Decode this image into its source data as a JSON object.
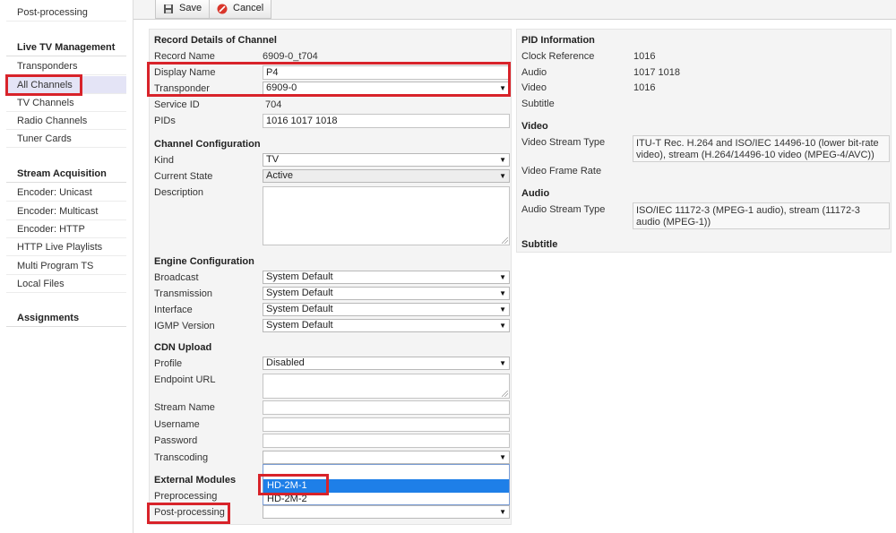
{
  "sidebar": {
    "top_item": "Post-processing",
    "section1": "Live TV Management",
    "items1": [
      "Transponders",
      "All Channels",
      "TV Channels",
      "Radio Channels",
      "Tuner Cards"
    ],
    "section2": "Stream Acquisition",
    "items2": [
      "Encoder: Unicast",
      "Encoder: Multicast",
      "Encoder: HTTP",
      "HTTP Live Playlists",
      "Multi Program TS",
      "Local Files"
    ],
    "section3": "Assignments"
  },
  "toolbar": {
    "save_label": "Save",
    "cancel_label": "Cancel"
  },
  "record": {
    "title": "Record Details of Channel",
    "record_name_label": "Record Name",
    "record_name": "6909-0_t704",
    "display_name_label": "Display Name",
    "display_name": "P4",
    "transponder_label": "Transponder",
    "transponder": "6909-0",
    "service_id_label": "Service ID",
    "service_id": "704",
    "pids_label": "PIDs",
    "pids": "1016 1017 1018"
  },
  "channel_config": {
    "title": "Channel Configuration",
    "kind_label": "Kind",
    "kind": "TV",
    "state_label": "Current State",
    "state": "Active",
    "description_label": "Description"
  },
  "engine": {
    "title": "Engine Configuration",
    "broadcast_label": "Broadcast",
    "broadcast": "System Default",
    "transmission_label": "Transmission",
    "transmission": "System Default",
    "interface_label": "Interface",
    "interface": "System Default",
    "igmp_label": "IGMP Version",
    "igmp": "System Default"
  },
  "cdn": {
    "title": "CDN Upload",
    "profile_label": "Profile",
    "profile": "Disabled",
    "endpoint_label": "Endpoint URL",
    "stream_name_label": "Stream Name",
    "username_label": "Username",
    "password_label": "Password",
    "transcoding_label": "Transcoding"
  },
  "modules": {
    "title": "External Modules",
    "preprocessing_label": "Preprocessing",
    "postprocessing_label": "Post-processing",
    "dropdown_options": [
      "HD-2M-1",
      "HD-2M-2"
    ]
  },
  "pid_info": {
    "title": "PID Information",
    "clock_label": "Clock Reference",
    "clock": "1016",
    "audio_label": "Audio",
    "audio": "1017 1018",
    "video_label": "Video",
    "video": "1016",
    "subtitle_label": "Subtitle"
  },
  "video": {
    "title": "Video",
    "stream_type_label": "Video Stream Type",
    "stream_type_line1": "ITU-T Rec. H.264 and ISO/IEC 14496-10 (lower bit-rate",
    "stream_type_line2": "video), stream (H.264/14496-10 video (MPEG-4/AVC))",
    "frame_rate_label": "Video Frame Rate"
  },
  "audio": {
    "title": "Audio",
    "stream_type_label": "Audio Stream Type",
    "stream_type_line1": "ISO/IEC 11172-3 (MPEG-1 audio), stream (11172-3",
    "stream_type_line2": "audio (MPEG-1))"
  },
  "subtitle": {
    "title": "Subtitle"
  },
  "colors": {
    "highlight": "#d8232a",
    "selected_option": "#1e7fe8",
    "active_sidebar": "#e4e4f6"
  }
}
